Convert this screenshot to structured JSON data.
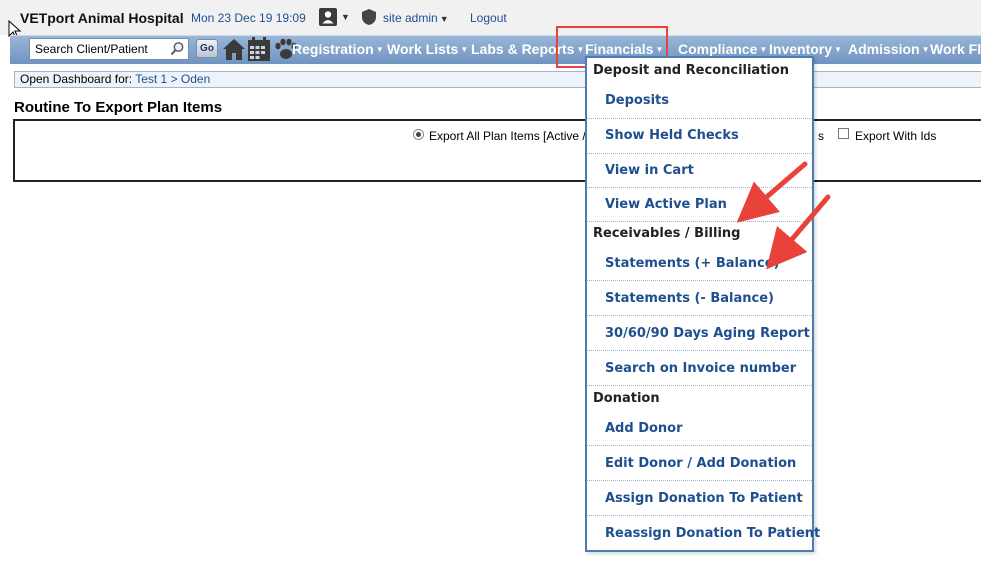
{
  "header": {
    "hospital_name": "VETport Animal Hospital",
    "datetime": "Mon 23 Dec 19 19:09",
    "user_label": "site admin",
    "logout_label": "Logout"
  },
  "nav": {
    "search_placeholder": "Search Client/Patient",
    "go_label": "Go",
    "icons": [
      "home-icon",
      "calendar-icon",
      "paw-icon"
    ],
    "menu_items": [
      "Registration",
      "Work Lists",
      "Labs & Reports",
      "Financials",
      "Compliance",
      "Inventory",
      "Admission",
      "Work Flo"
    ],
    "bar_color": "#7f9fc9",
    "highlight_color": "#e8423b"
  },
  "breadcrumb": {
    "prefix": "Open Dashboard for:",
    "client": "Test 1",
    "separator": ">",
    "patient": "Oden"
  },
  "page": {
    "title": "Routine To Export Plan Items",
    "radio_label": "Export All Plan Items [Active /",
    "hidden_suffix": "s",
    "checkbox_label": "Export With Ids"
  },
  "dropdown": {
    "sections": [
      {
        "header": "Deposit and Reconciliation",
        "items": [
          "Deposits",
          "Show Held Checks",
          "View in Cart",
          "View Active Plan"
        ]
      },
      {
        "header": "Receivables / Billing",
        "items": [
          "Statements (+ Balance)",
          "Statements (- Balance)",
          "30/60/90 Days Aging Report",
          "Search on Invoice number"
        ]
      },
      {
        "header": "Donation",
        "items": [
          "Add Donor",
          "Edit Donor / Add Donation",
          "Assign Donation To Patient",
          "Reassign Donation To Patient"
        ]
      }
    ]
  }
}
